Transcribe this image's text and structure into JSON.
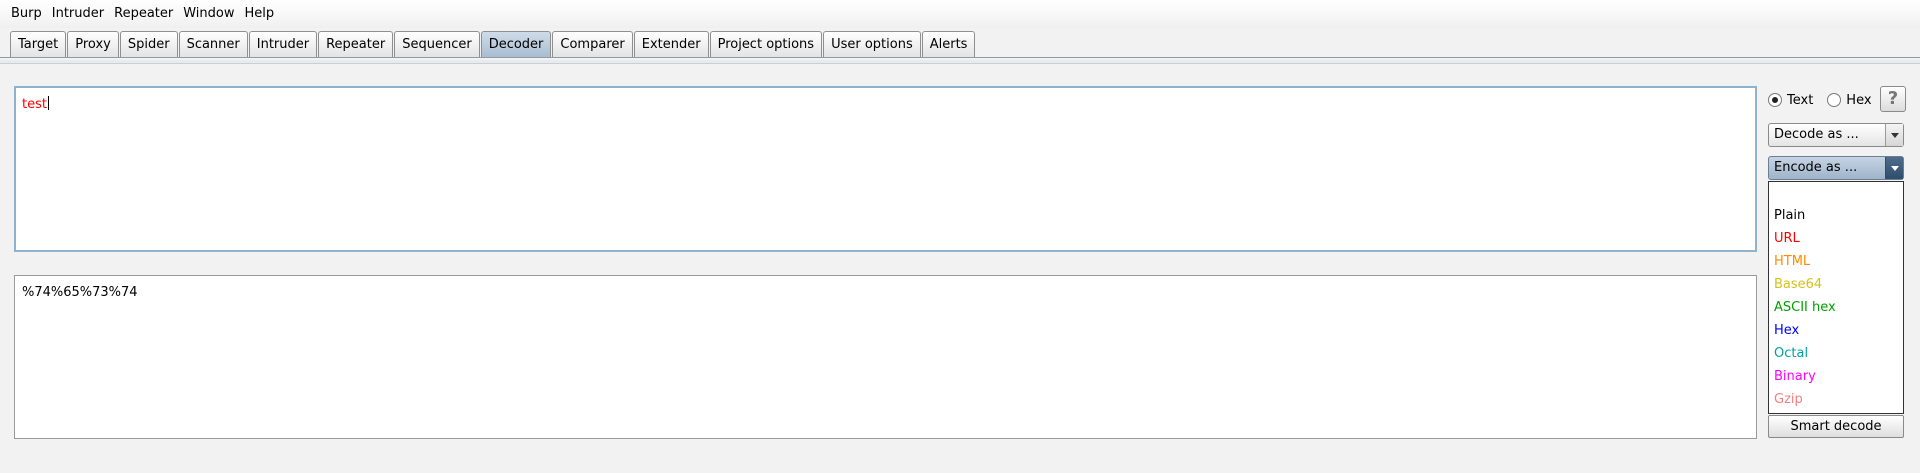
{
  "menubar": {
    "items": [
      "Burp",
      "Intruder",
      "Repeater",
      "Window",
      "Help"
    ]
  },
  "tabs": {
    "items": [
      "Target",
      "Proxy",
      "Spider",
      "Scanner",
      "Intruder",
      "Repeater",
      "Sequencer",
      "Decoder",
      "Comparer",
      "Extender",
      "Project options",
      "User options",
      "Alerts"
    ],
    "active": "Decoder"
  },
  "decoder": {
    "input_text": "test",
    "output_text": "%74%65%73%74",
    "mode": {
      "text_label": "Text",
      "hex_label": "Hex",
      "selected": "Text"
    },
    "help_label": "?",
    "decode_as_label": "Decode as ...",
    "encode_as_label": "Encode as ...",
    "encode_options": [
      {
        "label": "Plain",
        "color": "#000000"
      },
      {
        "label": "URL",
        "color": "#ff0000"
      },
      {
        "label": "HTML",
        "color": "#ff8c00"
      },
      {
        "label": "Base64",
        "color": "#d6c21a"
      },
      {
        "label": "ASCII hex",
        "color": "#00a000"
      },
      {
        "label": "Hex",
        "color": "#0000ff"
      },
      {
        "label": "Octal",
        "color": "#00a0a0"
      },
      {
        "label": "Binary",
        "color": "#ff00ff"
      },
      {
        "label": "Gzip",
        "color": "#f08080"
      }
    ],
    "smart_decode_label": "Smart decode"
  }
}
